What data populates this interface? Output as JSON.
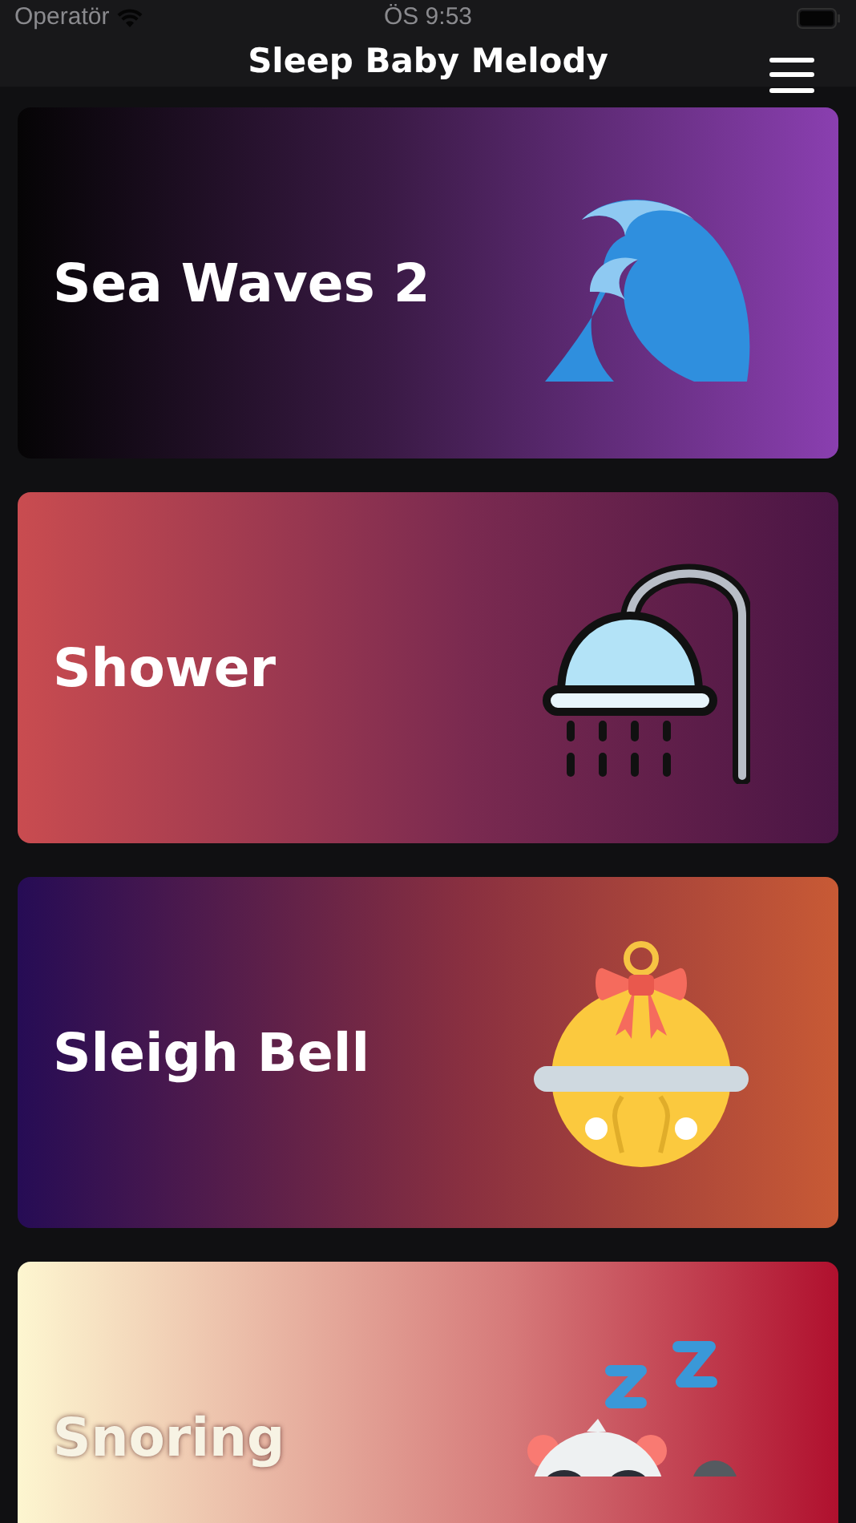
{
  "status_bar": {
    "carrier": "Operatör",
    "time": "ÖS 9:53"
  },
  "nav": {
    "title": "Sleep Baby Melody"
  },
  "sounds": [
    {
      "title": "Sea Waves 2",
      "kind": "waves"
    },
    {
      "title": "Shower",
      "kind": "shower"
    },
    {
      "title": "Sleigh Bell",
      "kind": "bell"
    },
    {
      "title": "Snoring",
      "kind": "snoring"
    }
  ]
}
